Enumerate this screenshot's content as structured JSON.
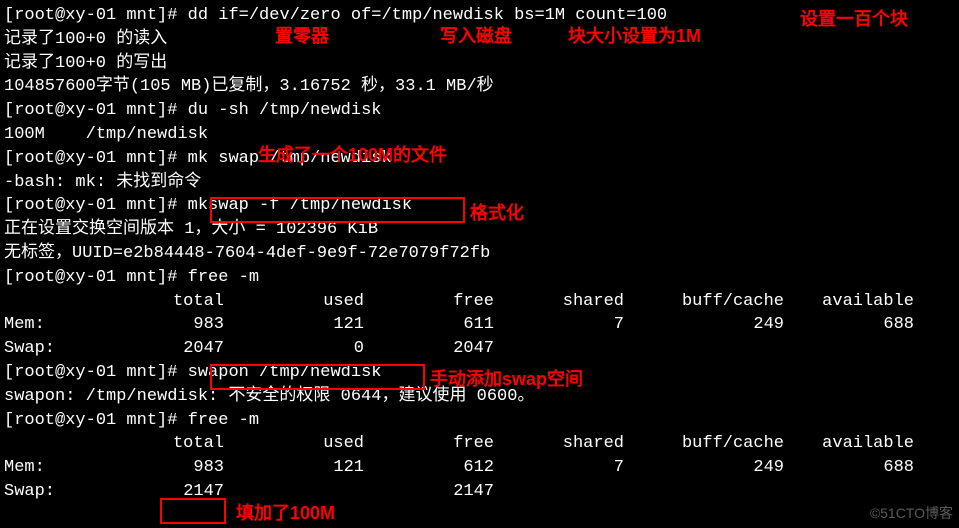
{
  "prompt": "[root@xy-01 mnt]# ",
  "lines": {
    "l1_cmd": "dd if=/dev/zero of=/tmp/newdisk bs=1M count=100",
    "l2": "记录了100+0 的读入",
    "l3": "记录了100+0 的写出",
    "l4": "104857600字节(105 MB)已复制，3.16752 秒，33.1 MB/秒",
    "l5_cmd": "du -sh /tmp/newdisk",
    "l6": "100M    /tmp/newdisk",
    "l7_cmd": "mk swap /tmp/newdisk",
    "l8": "-bash: mk: 未找到命令",
    "l9_cmd": "mkswap -f /tmp/newdisk",
    "l10": "正在设置交换空间版本 1，大小 = 102396 KiB",
    "l11": "无标签，UUID=e2b84448-7604-4def-9e9f-72e7079f72fb",
    "l12_cmd": "free -m",
    "l15_cmd": "swapon /tmp/newdisk",
    "l16": "swapon: /tmp/newdisk: 不安全的权限 0644，建议使用 0600。",
    "l17_cmd": "free -m"
  },
  "free1": {
    "hdr": {
      "total": "total",
      "used": "used",
      "free": "free",
      "shared": "shared",
      "buff": "buff/cache",
      "avail": "available"
    },
    "mem": {
      "lbl": "Mem:",
      "total": "983",
      "used": "121",
      "free": "611",
      "shared": "7",
      "buff": "249",
      "avail": "688"
    },
    "swap": {
      "lbl": "Swap:",
      "total": "2047",
      "used": "0",
      "free": "2047",
      "shared": "",
      "buff": "",
      "avail": ""
    }
  },
  "free2": {
    "hdr": {
      "total": "total",
      "used": "used",
      "free": "free",
      "shared": "shared",
      "buff": "buff/cache",
      "avail": "available"
    },
    "mem": {
      "lbl": "Mem:",
      "total": "983",
      "used": "121",
      "free": "612",
      "shared": "7",
      "buff": "249",
      "avail": "688"
    },
    "swap": {
      "lbl": "Swap:",
      "total": "2147",
      "used": "",
      "free": "2147",
      "shared": "",
      "buff": "",
      "avail": ""
    }
  },
  "ann": {
    "a1": "置零器",
    "a2": "写入磁盘",
    "a3": "块大小设置为1M",
    "a4": "设置一百个块",
    "a5": "生成了一个100M的文件",
    "a6": "格式化",
    "a7": "手动添加swap空间",
    "a8": "填加了100M"
  },
  "watermark": "©51CTO博客"
}
